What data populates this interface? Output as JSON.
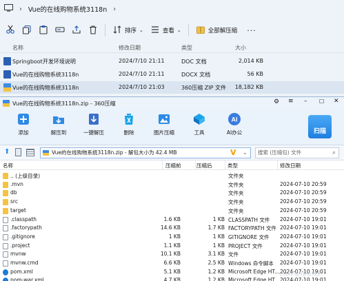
{
  "explorer": {
    "address": {
      "title": "Vue的在线购物系统3118n"
    },
    "toolbar": {
      "sort": "排序",
      "view": "查看",
      "extract_all": "全部解压缩"
    },
    "columns": {
      "name": "名称",
      "modified": "修改日期",
      "type": "类型",
      "size": "大小"
    },
    "files": [
      {
        "name": "Springboot开发环境说明",
        "modified": "2024/7/10 21:11",
        "type": "DOC 文档",
        "size": "2,014 KB",
        "icon": "word-doc-icon"
      },
      {
        "name": "Vue的在线购物系统3118n",
        "modified": "2024/7/10 21:11",
        "type": "DOCX 文档",
        "size": "56 KB",
        "icon": "word-docx-icon"
      },
      {
        "name": "Vue的在线购物系统3118n",
        "modified": "2024/7/10 21:03",
        "type": "360压缩 ZIP 文件",
        "size": "18,182 KB",
        "icon": "zip-archive-icon"
      }
    ]
  },
  "zipwin": {
    "title": "Vue的在线购物系统3118n.zip - 360压缩",
    "toolbar": [
      {
        "label": "添加",
        "icon": "add-icon",
        "color": "#2d8ae6"
      },
      {
        "label": "解压到",
        "icon": "extract-to-icon",
        "color": "#2d8ae6"
      },
      {
        "label": "一键解压",
        "icon": "one-click-extract-icon",
        "color": "#3b6fc8"
      },
      {
        "label": "删除",
        "icon": "delete-icon",
        "color": "#1aa3e8"
      },
      {
        "label": "图片压缩",
        "icon": "image-compress-icon",
        "color": "#2d8ae6"
      },
      {
        "label": "工具",
        "icon": "tools-icon",
        "color": "#1aa3e8"
      },
      {
        "label": "AI办公",
        "icon": "ai-office-icon",
        "color": "#3a7be0"
      }
    ],
    "scan_label": "扫描",
    "path": "Vue的在线购物系统3118n.zip - 解包大小为 42.4 MB",
    "search_placeholder": "搜索 (压缩包) 文件",
    "columns": {
      "name": "名称",
      "compressed": "压缩前",
      "packed": "压缩后",
      "type": "类型",
      "modified": "修改日期"
    },
    "rows": [
      {
        "name": ".. (上级目录)",
        "compressed": "",
        "packed": "",
        "type": "文件夹",
        "modified": "",
        "icon": "folder"
      },
      {
        "name": ".mvn",
        "compressed": "",
        "packed": "",
        "type": "文件夹",
        "modified": "2024-07-10 20:59",
        "icon": "folder"
      },
      {
        "name": "db",
        "compressed": "",
        "packed": "",
        "type": "文件夹",
        "modified": "2024-07-10 20:59",
        "icon": "folder"
      },
      {
        "name": "src",
        "compressed": "",
        "packed": "",
        "type": "文件夹",
        "modified": "2024-07-10 20:59",
        "icon": "folder"
      },
      {
        "name": "target",
        "compressed": "",
        "packed": "",
        "type": "文件夹",
        "modified": "2024-07-10 20:59",
        "icon": "folder"
      },
      {
        "name": ".classpath",
        "compressed": "1.6 KB",
        "packed": "1 KB",
        "type": "CLASSPATH 文件",
        "modified": "2024-07-10 19:01",
        "icon": "doc"
      },
      {
        "name": ".factorypath",
        "compressed": "14.6 KB",
        "packed": "1.7 KB",
        "type": "FACTORYPATH 文件",
        "modified": "2024-07-10 19:01",
        "icon": "doc"
      },
      {
        "name": ".gitignore",
        "compressed": "1 KB",
        "packed": "1 KB",
        "type": "GITIGNORE 文件",
        "modified": "2024-07-10 19:01",
        "icon": "doc"
      },
      {
        "name": ".project",
        "compressed": "1.1 KB",
        "packed": "1 KB",
        "type": "PROJECT 文件",
        "modified": "2024-07-10 19:01",
        "icon": "doc"
      },
      {
        "name": "mvnw",
        "compressed": "10.1 KB",
        "packed": "3.1 KB",
        "type": "文件",
        "modified": "2024-07-10 19:01",
        "icon": "doc"
      },
      {
        "name": "mvnw.cmd",
        "compressed": "6.6 KB",
        "packed": "2.5 KB",
        "type": "Windows 命令脚本",
        "modified": "2024-07-10 19:01",
        "icon": "doc"
      },
      {
        "name": "pom.xml",
        "compressed": "5.1 KB",
        "packed": "1.2 KB",
        "type": "Microsoft Edge HT...",
        "modified": "2024-07-10 19:01",
        "icon": "edge"
      },
      {
        "name": "pom-war.xml",
        "compressed": "4.7 KB",
        "packed": "1.2 KB",
        "type": "Microsoft Edge HT...",
        "modified": "2024-07-10 19:01",
        "icon": "edge"
      }
    ]
  },
  "watermark": "CSDN @hanji722"
}
